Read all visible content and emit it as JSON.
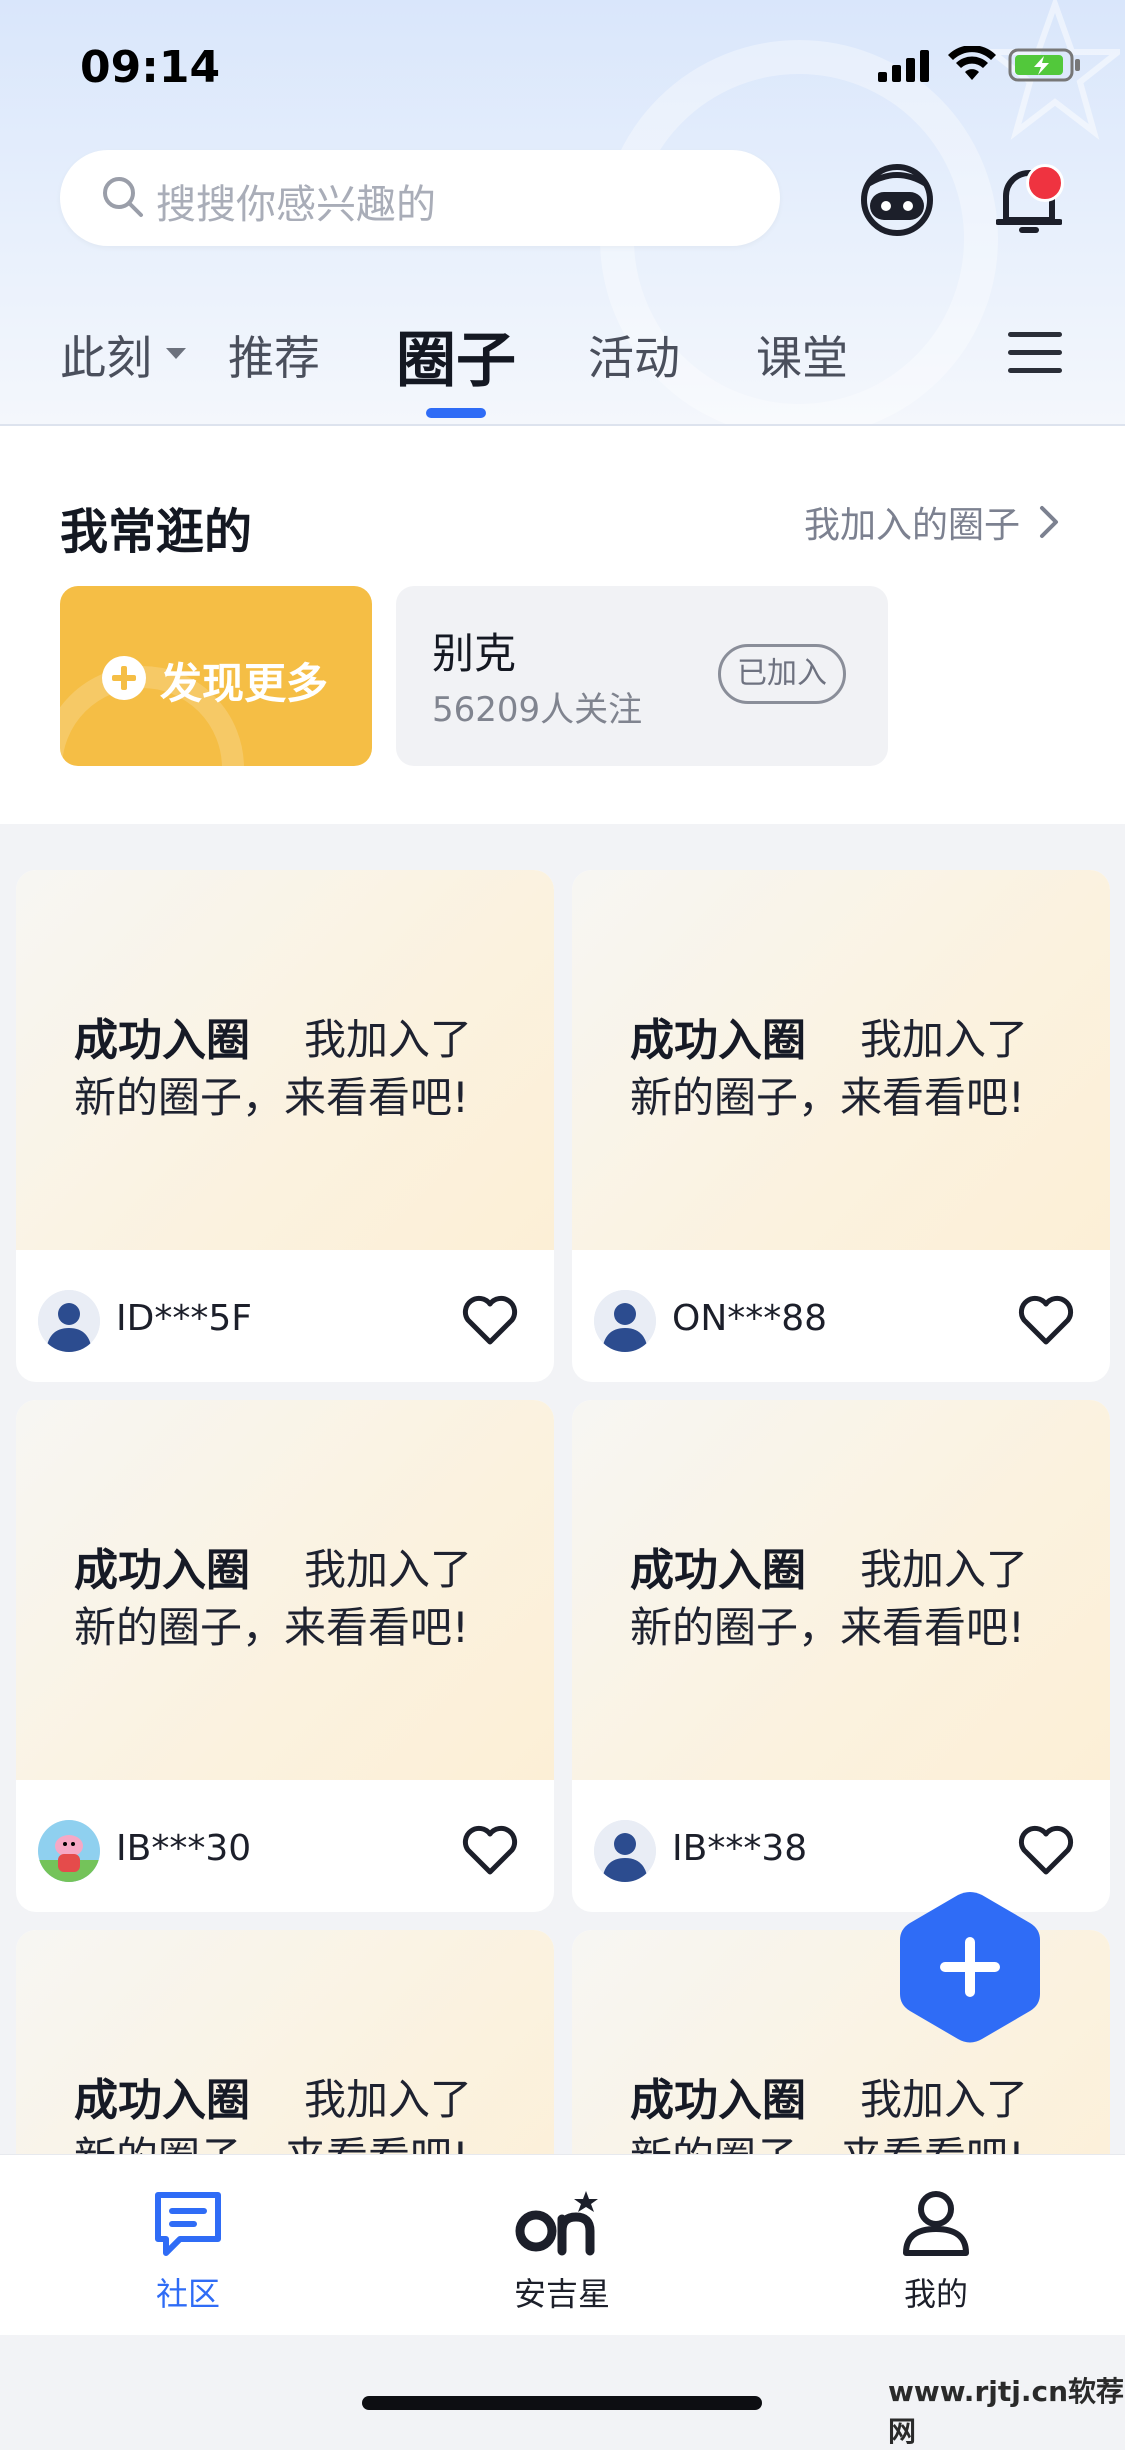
{
  "status_bar": {
    "time": "09:14"
  },
  "search": {
    "placeholder": "搜搜你感兴趣的"
  },
  "header_icons": [
    "assistant-icon",
    "bell-icon"
  ],
  "tabs": [
    {
      "label": "此刻",
      "has_dropdown": true
    },
    {
      "label": "推荐"
    },
    {
      "label": "圈子",
      "active": true
    },
    {
      "label": "活动"
    },
    {
      "label": "课堂"
    }
  ],
  "frequent": {
    "title": "我常逛的",
    "joined_link": "我加入的圈子",
    "discover_label": "发现更多",
    "circle": {
      "name": "别克",
      "followers": "56209人关注",
      "badge": "已加入"
    }
  },
  "posts": [
    {
      "title": "成功入圈",
      "text1": "我加入了",
      "text2": "新的圈子，来看看吧!",
      "user": "ID***5F",
      "avatar": "default-avatar"
    },
    {
      "title": "成功入圈",
      "text1": "我加入了",
      "text2": "新的圈子，来看看吧!",
      "user": "ON***88",
      "avatar": "default-avatar"
    },
    {
      "title": "成功入圈",
      "text1": "我加入了",
      "text2": "新的圈子，来看看吧!",
      "user": "IB***30",
      "avatar": "cartoon-avatar"
    },
    {
      "title": "成功入圈",
      "text1": "我加入了",
      "text2": "新的圈子，来看看吧!",
      "user": "IB***38",
      "avatar": "default-avatar"
    },
    {
      "title": "成功入圈",
      "text1": "我加入了",
      "text2": "新的圈子，来看看吧!",
      "user": "",
      "avatar": ""
    },
    {
      "title": "成功入圈",
      "text1": "我加入了",
      "text2": "新的圈子，来看看吧!",
      "user": "",
      "avatar": ""
    }
  ],
  "bottom_nav": [
    {
      "label": "社区",
      "icon": "chat-icon",
      "active": true
    },
    {
      "label": "安吉星",
      "icon": "onstar-icon"
    },
    {
      "label": "我的",
      "icon": "profile-icon"
    }
  ],
  "watermark": "www.rjtj.cn软荐网",
  "colors": {
    "accent": "#2f6cf6",
    "discover": "#f5be45",
    "notification": "#ef3340"
  }
}
